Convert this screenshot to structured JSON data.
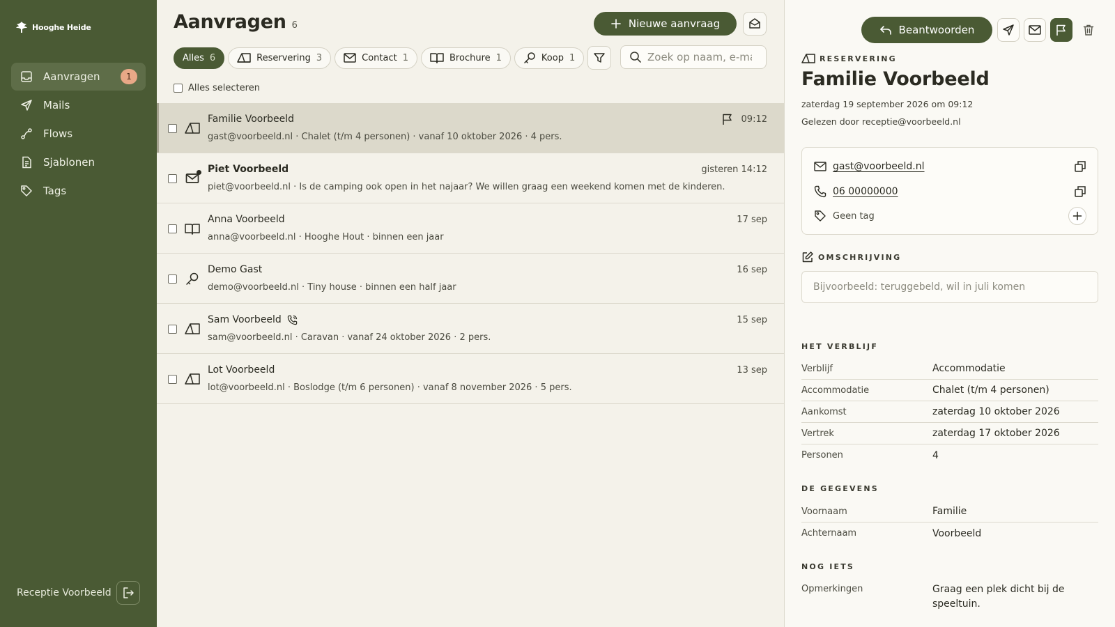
{
  "brand": {
    "name": "Hooghe Heide"
  },
  "sidebar": {
    "items": [
      {
        "label": "Aanvragen",
        "icon": "inbox-icon",
        "badge": "1",
        "active": true
      },
      {
        "label": "Mails",
        "icon": "send-icon"
      },
      {
        "label": "Flows",
        "icon": "flow-icon"
      },
      {
        "label": "Sjablonen",
        "icon": "document-icon"
      },
      {
        "label": "Tags",
        "icon": "tag-icon"
      }
    ],
    "user": "Receptie Voorbeeld"
  },
  "list": {
    "title": "Aanvragen",
    "count": "6",
    "new_button": "Nieuwe aanvraag",
    "filters": [
      {
        "label": "Alles",
        "count": "6",
        "active": true
      },
      {
        "label": "Reservering",
        "count": "3",
        "icon": "tent-icon"
      },
      {
        "label": "Contact",
        "count": "1",
        "icon": "mail-icon"
      },
      {
        "label": "Brochure",
        "count": "1",
        "icon": "book-icon"
      },
      {
        "label": "Koop",
        "count": "1",
        "icon": "key-icon"
      }
    ],
    "search_placeholder": "Zoek op naam, e-mail…",
    "select_all": "Alles selecteren",
    "rows": [
      {
        "name": "Familie Voorbeeld",
        "snippet": "gast@voorbeeld.nl · Chalet (t/m 4 personen) · vanaf 10 oktober 2026 · 4 pers.",
        "time": "09:12",
        "type": "tent-icon",
        "selected": true,
        "flagged": true
      },
      {
        "name": "Piet Voorbeeld",
        "snippet": "piet@voorbeeld.nl · Is de camping ook open in het najaar? We willen graag een weekend komen met de kinderen.",
        "time": "gisteren 14:12",
        "type": "mail-icon",
        "unread": true
      },
      {
        "name": "Anna Voorbeeld",
        "snippet": "anna@voorbeeld.nl · Hooghe Hout · binnen een jaar",
        "time": "17 sep",
        "type": "book-icon"
      },
      {
        "name": "Demo Gast",
        "snippet": "demo@voorbeeld.nl · Tiny house · binnen een half jaar",
        "time": "16 sep",
        "type": "key-icon"
      },
      {
        "name": "Sam Voorbeeld",
        "snippet": "sam@voorbeeld.nl · Caravan · vanaf 24 oktober 2026 · 2 pers.",
        "time": "15 sep",
        "type": "tent-icon",
        "phone": true
      },
      {
        "name": "Lot Voorbeeld",
        "snippet": "lot@voorbeeld.nl · Boslodge (t/m 6 personen) · vanaf 8 november 2026 · 5 pers.",
        "time": "13 sep",
        "type": "tent-icon"
      }
    ]
  },
  "detail": {
    "reply_button": "Beantwoorden",
    "kicker": "RESERVERING",
    "title": "Familie Voorbeeld",
    "date": "zaterdag 19 september 2026 om 09:12",
    "read_by": "Gelezen door receptie@voorbeeld.nl",
    "email": "gast@voorbeeld.nl",
    "phone": "06 00000000",
    "tag": "Geen tag",
    "description_label": "OMSCHRIJVING",
    "description_placeholder": "Bijvoorbeeld: teruggebeld, wil in juli komen",
    "stay_label": "HET VERBLIJF",
    "stay": [
      {
        "k": "Verblijf",
        "v": "Accommodatie"
      },
      {
        "k": "Accommodatie",
        "v": "Chalet (t/m 4 personen)"
      },
      {
        "k": "Aankomst",
        "v": "zaterdag 10 oktober 2026"
      },
      {
        "k": "Vertrek",
        "v": "zaterdag 17 oktober 2026"
      },
      {
        "k": "Personen",
        "v": "4"
      }
    ],
    "data_label": "DE GEGEVENS",
    "data": [
      {
        "k": "Voornaam",
        "v": "Familie"
      },
      {
        "k": "Achternaam",
        "v": "Voorbeeld"
      }
    ],
    "extra_label": "NOG IETS",
    "note_key": "Opmerkingen",
    "note_value": "Graag een plek dicht bij de speeltuin."
  },
  "colors": {
    "sidebar": "#4a5a34",
    "accent": "#4a5a34",
    "badge": "#e8a887",
    "background": "#f4f2ea"
  }
}
